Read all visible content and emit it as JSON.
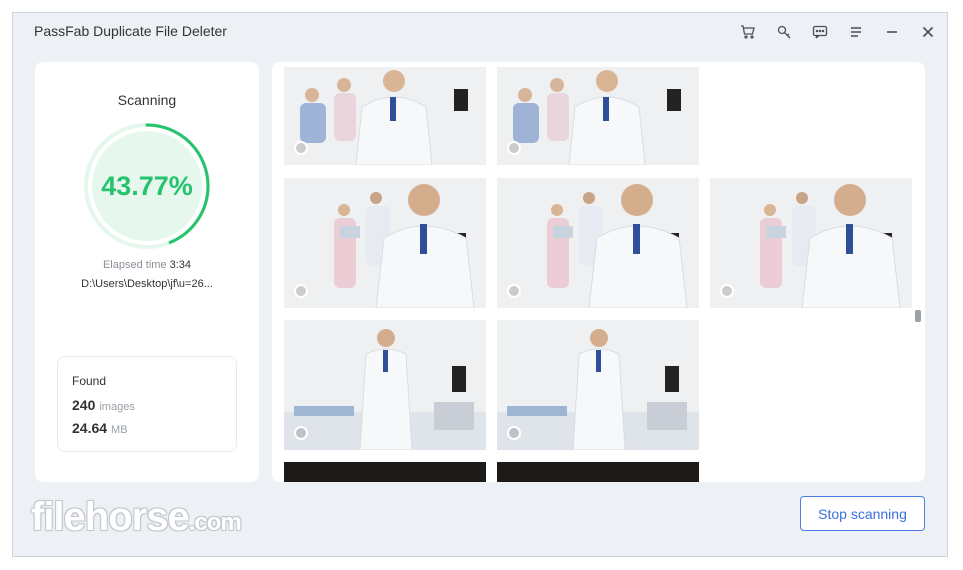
{
  "window": {
    "title": "PassFab Duplicate File Deleter",
    "icons": [
      "cart-icon",
      "key-icon",
      "feedback-icon",
      "menu-icon",
      "minimize-icon",
      "close-icon"
    ]
  },
  "scan": {
    "label": "Scanning",
    "percent_text": "43.77%",
    "progress_fraction": 0.4377,
    "elapsed_label": "Elapsed time",
    "elapsed_value": "3:34",
    "current_path": "D:\\Users\\Desktop\\jf\\u=26..."
  },
  "found": {
    "title": "Found",
    "count": "240",
    "count_unit": "images",
    "size": "24.64",
    "size_unit": "MB"
  },
  "thumbnails": [
    {
      "group": 1,
      "subject": "doctor-group"
    },
    {
      "group": 1,
      "subject": "doctor-group"
    },
    {
      "group": 2,
      "subject": "doctor-with-clipboard"
    },
    {
      "group": 2,
      "subject": "doctor-with-clipboard"
    },
    {
      "group": 2,
      "subject": "doctor-with-clipboard"
    },
    {
      "group": 3,
      "subject": "doctor-in-clinic"
    },
    {
      "group": 3,
      "subject": "doctor-in-clinic"
    }
  ],
  "watermark": {
    "main": "filehorse",
    "suffix": ".com"
  },
  "actions": {
    "stop_label": "Stop scanning"
  },
  "colors": {
    "accent_green": "#27c26d",
    "accent_blue": "#3b6fe0"
  }
}
